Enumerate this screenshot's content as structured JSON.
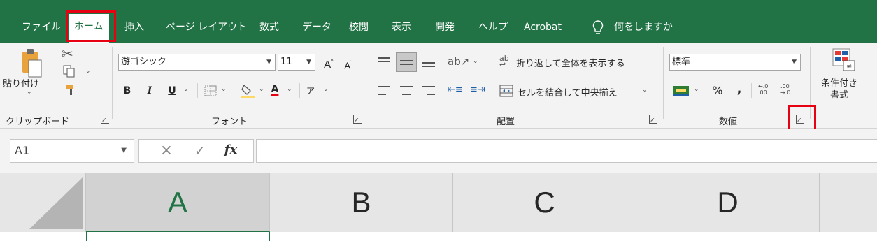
{
  "tabs": [
    "ファイル",
    "ホーム",
    "挿入",
    "ページ レイアウト",
    "数式",
    "データ",
    "校閲",
    "表示",
    "開発",
    "ヘルプ",
    "Acrobat"
  ],
  "tell_me": "何をしますか",
  "clipboard": {
    "paste": "貼り付け",
    "group": "クリップボード"
  },
  "font": {
    "name": "游ゴシック",
    "size": "11",
    "grow": "A",
    "shrink": "A",
    "bold": "B",
    "italic": "I",
    "underline": "U",
    "font_color_letter": "A",
    "phonetic": "ア",
    "group": "フォント",
    "font_color_hex": "#e60012"
  },
  "alignment": {
    "wrap_text": "折り返して全体を表示する",
    "merge_center": "セルを結合して中央揃え",
    "group": "配置"
  },
  "number": {
    "format": "標準",
    "percent": "%",
    "comma": ",",
    "increase_decimal": "←.0 .00",
    "decrease_decimal": ".00 →.0",
    "group": "数値"
  },
  "styles": {
    "conditional_formatting": "条件付き\n書式"
  },
  "formula_bar": {
    "name_box": "A1",
    "cancel": "×",
    "enter": "✓",
    "fx": "fx",
    "formula": ""
  },
  "columns": [
    "A",
    "B",
    "C",
    "D"
  ],
  "colors": {
    "brand": "#217346",
    "highlight": "#e60012",
    "ribbon_bg": "#f3f3f3"
  }
}
